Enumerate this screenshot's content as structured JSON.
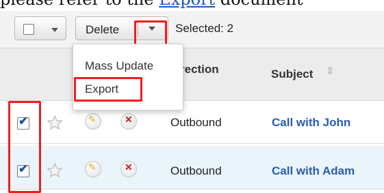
{
  "doc_text": {
    "prefix": "please refer to the ",
    "link": "Export",
    "suffix": " document"
  },
  "toolbar": {
    "delete_label": "Delete",
    "selected_label": "Selected: 2"
  },
  "table": {
    "columns": [
      "Direction",
      "Subject"
    ],
    "sort_icon": "⇳",
    "rows": [
      {
        "checked": true,
        "direction": "Outbound",
        "subject": "Call with John"
      },
      {
        "checked": true,
        "direction": "Outbound",
        "subject": "Call with Adam"
      }
    ]
  },
  "menu": {
    "items": [
      "Mass Update",
      "Export"
    ]
  },
  "icons": {
    "select_all": "checkbox-dropdown-icon",
    "more": "caret-down-icon",
    "favorite": "star-icon",
    "edit": "pencil-icon",
    "delete": "close-icon"
  },
  "colors": {
    "highlight": "#f01d1d",
    "link": "#2a5bb6",
    "selected_row_bg": "#eaf4fb"
  }
}
